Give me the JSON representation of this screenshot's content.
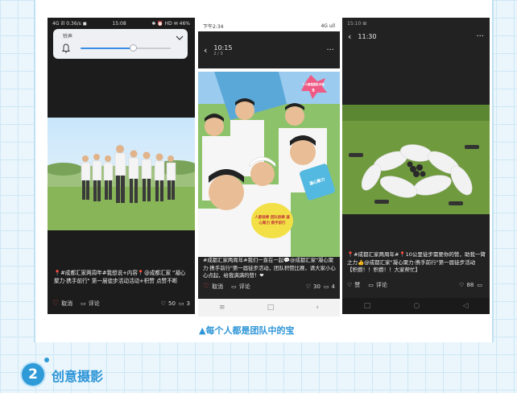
{
  "screen1": {
    "status_left": "4G ill 0.36/s ◼",
    "status_time": "15:08",
    "status_right": "✱ ⏰ HD ✉ 46%",
    "volume_label": "铃声",
    "volume_level": 0.58,
    "caption": "📍#成都汇家两周年#我想说+内容📍@成都汇家 \"凝心聚力·携手前行\" 第一届徒步活动活动+积赞 点赞不断",
    "cancel_label": "取消",
    "comment_label": "评论",
    "likes": "50",
    "comments": "3"
  },
  "screen2": {
    "status_left": "下午2:34",
    "status_right": "4G ull",
    "title": "10:15",
    "subtitle": "2 / 3",
    "sign_pink": "个人都是团队中的宝",
    "sign_yellow": "人都很棒 团队很棒 凝心聚力 携手前行",
    "sign_blue": "凝心聚力",
    "caption": "#成都汇家两周年#我们一直在一起💬@成都汇家\"凝心聚力·携手前行\"第一届徒步活动，团队积赞比赛，请大家小心心点起，给我满满的赞！❤",
    "cancel_label": "取消",
    "comment_label": "评论",
    "likes": "30",
    "comments": "4"
  },
  "screen3": {
    "status_left": "15:10 ⊞",
    "status_right": "",
    "title": "11:30",
    "caption": "📍#成都汇家两周年#📍10公里徒步需要你的赞，助我一臂之力👍@成都汇家\"凝心聚力·携手前行\"第一届徒步活动【积攒！！积攒！！大家帮忙】",
    "like_label": "赞",
    "comment_label": "评论",
    "likes": "88",
    "comments": ""
  },
  "image_caption": "▲每个人都是团队中的宝",
  "section": {
    "number": "2",
    "title": "创意摄影"
  },
  "colors": {
    "accent": "#2d95d7",
    "page_bg": "#eaf6fc",
    "like_red": "#e04a4a"
  }
}
